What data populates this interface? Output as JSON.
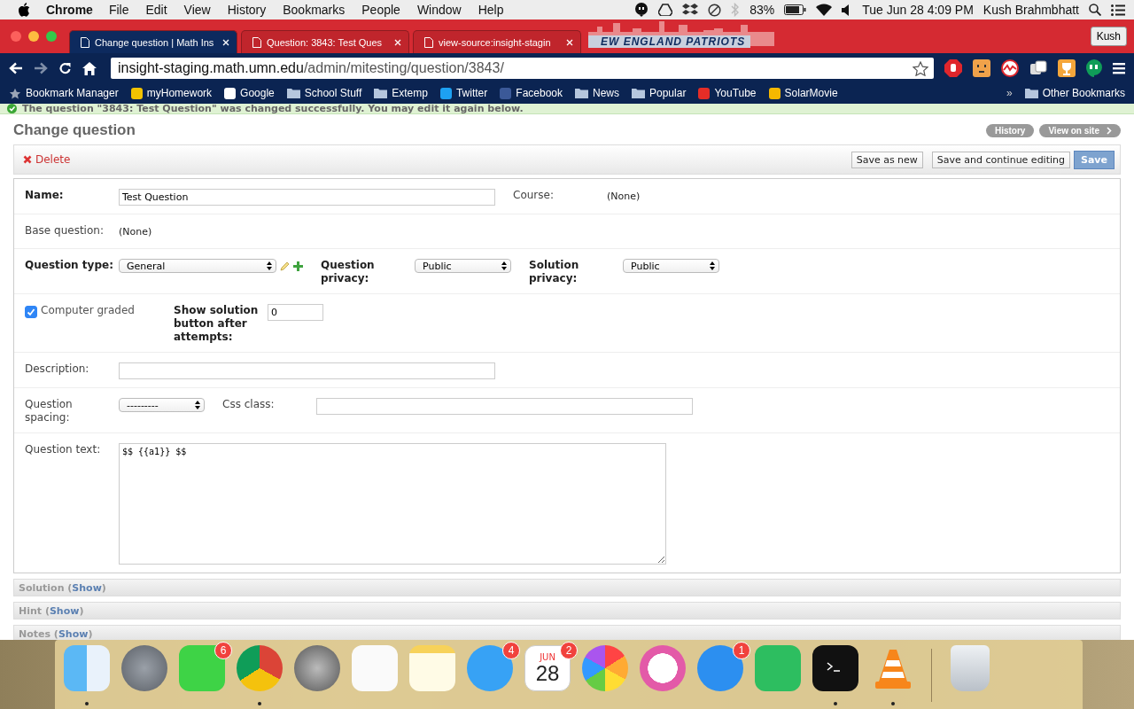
{
  "menubar": {
    "app": "Chrome",
    "menus": [
      "File",
      "Edit",
      "View",
      "History",
      "Bookmarks",
      "People",
      "Window",
      "Help"
    ],
    "battery": "83%",
    "clock": "Tue Jun 28  4:09 PM",
    "user": "Kush Brahmbhatt"
  },
  "tabs": [
    {
      "title": "Change question | Math Ins",
      "selected": true
    },
    {
      "title": "Question: 3843: Test Ques",
      "selected": false
    },
    {
      "title": "view-source:insight-stagin",
      "selected": false
    }
  ],
  "theme_banner": "EW ENGLAND PATRIOTS",
  "profile": "Kush",
  "address": {
    "host": "insight-staging.math.umn.edu",
    "path": "/admin/mitesting/question/3843/"
  },
  "bookmarks": [
    {
      "kind": "star",
      "label": "Bookmark Manager"
    },
    {
      "kind": "site",
      "label": "myHomework"
    },
    {
      "kind": "site",
      "label": "Google"
    },
    {
      "kind": "folder",
      "label": "School Stuff"
    },
    {
      "kind": "folder",
      "label": "Extemp"
    },
    {
      "kind": "site",
      "label": "Twitter"
    },
    {
      "kind": "site",
      "label": "Facebook"
    },
    {
      "kind": "folder",
      "label": "News"
    },
    {
      "kind": "folder",
      "label": "Popular"
    },
    {
      "kind": "site",
      "label": "YouTube"
    },
    {
      "kind": "site",
      "label": "SolarMovie"
    }
  ],
  "bookmarks_more": "»",
  "other_bookmarks": "Other Bookmarks",
  "message": "The question \"3843: Test Question\" was changed successfully. You may edit it again below.",
  "page_title": "Change question",
  "object_tools": [
    "History",
    "View on site"
  ],
  "delete_link": "Delete",
  "submit_buttons": [
    {
      "label": "Save as new",
      "default": false
    },
    {
      "label": "Save and continue editing",
      "default": false
    },
    {
      "label": "Save",
      "default": true
    }
  ],
  "form_rows": [
    {
      "fields": [
        {
          "kind": "text",
          "label": "Name:",
          "required": true,
          "value": "Test Question"
        },
        {
          "kind": "readonly",
          "label": "Course:",
          "required": false,
          "value": "(None)"
        }
      ]
    },
    {
      "fields": [
        {
          "kind": "readonly",
          "label": "Base question:",
          "required": false,
          "value": "(None)"
        }
      ]
    },
    {
      "fields": [
        {
          "kind": "select",
          "label": "Question type:",
          "required": true,
          "value": "General",
          "tools": true
        },
        {
          "kind": "select",
          "label": "Question privacy:",
          "required": true,
          "value": "Public"
        },
        {
          "kind": "select",
          "label": "Solution privacy:",
          "required": true,
          "value": "Public"
        }
      ]
    },
    {
      "fields": [
        {
          "kind": "checkbox",
          "label": "Computer graded",
          "checked": true
        },
        {
          "kind": "text",
          "label": "Show solution button after attempts:",
          "required": true,
          "value": "0"
        }
      ]
    },
    {
      "fields": [
        {
          "kind": "text",
          "label": "Description:",
          "required": false
        }
      ]
    },
    {
      "fields": [
        {
          "kind": "select",
          "label": "Question spacing:",
          "required": false,
          "value": "---------"
        },
        {
          "kind": "text",
          "label": "Css class:",
          "required": false
        }
      ]
    },
    {
      "fields": [
        {
          "kind": "textarea",
          "label": "Question text:",
          "required": false,
          "value": "$$ {{a1}} $$"
        }
      ]
    }
  ],
  "collapsed_sections": [
    {
      "prefix": "Solution (",
      "link": "Show",
      "suffix": ")"
    },
    {
      "prefix": "Hint (",
      "link": "Show",
      "suffix": ")"
    },
    {
      "prefix": "Notes (",
      "link": "Show",
      "suffix": ")"
    }
  ],
  "dock": [
    {
      "running": true
    },
    {
      "running": false
    },
    {
      "running": false,
      "badge": "6"
    },
    {
      "running": true
    },
    {
      "running": false
    },
    {
      "running": false
    },
    {
      "running": false
    },
    {
      "running": false,
      "badge": "4"
    },
    {
      "running": false,
      "badge": "2",
      "month": "JUN",
      "day": "28"
    },
    {
      "running": false
    },
    {
      "running": false
    },
    {
      "running": false,
      "badge": "1"
    },
    {
      "running": false
    },
    {
      "running": true
    },
    {
      "running": true
    },
    {
      "kind": "separator"
    },
    {
      "running": false
    }
  ]
}
